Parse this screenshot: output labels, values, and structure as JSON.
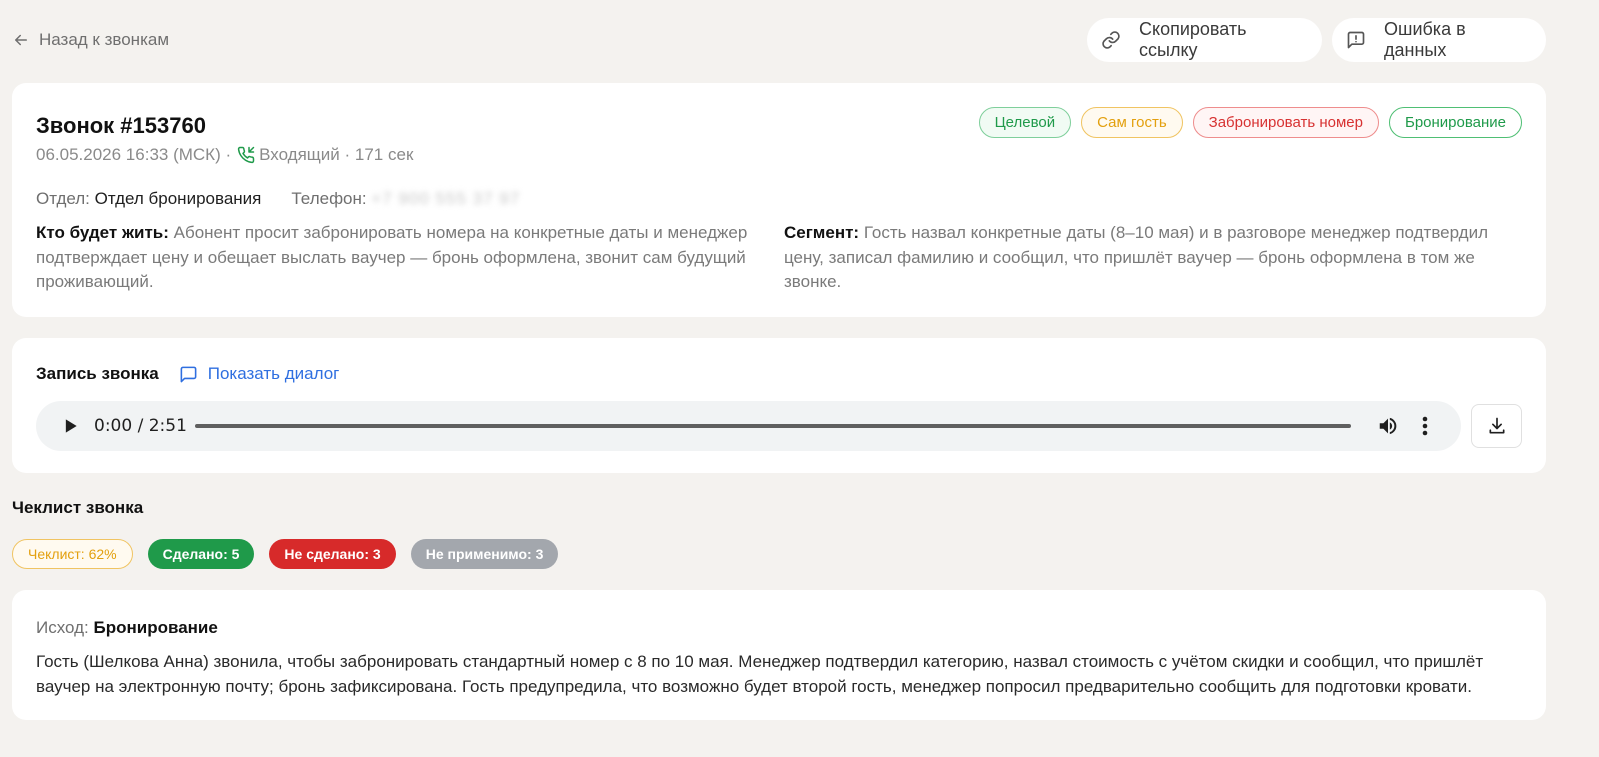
{
  "nav": {
    "back_label": "Назад к звонкам"
  },
  "actions": {
    "copy_link": "Скопировать ссылку",
    "report_error": "Ошибка в данных"
  },
  "call": {
    "title": "Звонок #153760",
    "datetime": "06.05.2026 16:33 (МСК) ·",
    "direction": "Входящий",
    "duration": "· 171 сек",
    "department_label": "Отдел:",
    "department": "Отдел бронирования",
    "phone_label": "Телефон:",
    "phone": "+7 900 555 37 97",
    "tags": [
      {
        "label": "Целевой",
        "color": "#1f9a4a"
      },
      {
        "label": "Сам гость",
        "color": "#e3a00f"
      },
      {
        "label": "Забронировать номер",
        "color": "#d73232"
      },
      {
        "label": "Бронирование",
        "color": "#1f9a4a"
      }
    ],
    "who_label": "Кто будет жить:",
    "who_text": "Абонент просит забронировать номера на конкретные даты и менеджер подтверждает цену и обещает выслать ваучер — бронь оформлена, звонит сам будущий проживающий.",
    "segment_label": "Сегмент:",
    "segment_text": "Гость назвал конкретные даты (8–10 мая) и в разговоре менеджер подтвердил цену, записал фамилию и сообщил, что пришлёт ваучер — бронь оформлена в том же звонке."
  },
  "recording": {
    "title": "Запись звонка",
    "show_dialog": "Показать диалог",
    "time": "0:00 / 2:51",
    "progress": 0
  },
  "checklist": {
    "title": "Чеклист звонка",
    "score": "Чеклист: 62%",
    "done": "Сделано: 5",
    "not_done": "Не сделано: 3",
    "not_applicable": "Не применимо: 3"
  },
  "outcome": {
    "label": "Исход:",
    "value": "Бронирование",
    "text": "Гость (Шелкова Анна) звонила, чтобы забронировать стандартный номер с 8 по 10 мая. Менеджер подтвердил категорию, назвал стоимость с учётом скидки и сообщил, что пришлёт ваучер на электронную почту; бронь зафиксирована. Гость предупредила, что возможно будет второй гость, менеджер попросил предварительно сообщить для подготовки кровати."
  }
}
